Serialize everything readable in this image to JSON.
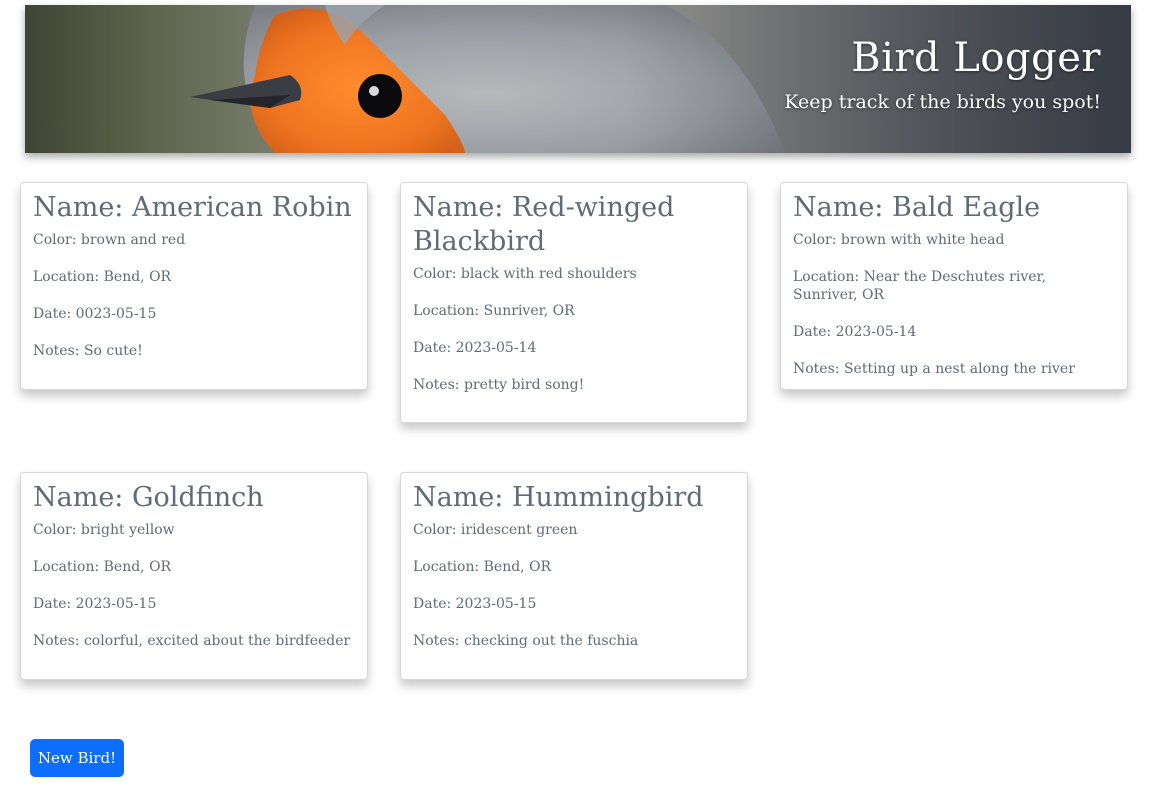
{
  "header": {
    "title": "Bird Logger",
    "subtitle": "Keep track of the birds you spot!"
  },
  "birds": [
    {
      "name": "Name: American Robin",
      "color": "Color: brown and red",
      "location": "Location: Bend, OR",
      "date": "Date: 0023-05-15",
      "notes": "Notes: So cute!"
    },
    {
      "name": "Name: Red-winged Blackbird",
      "color": "Color: black with red shoulders",
      "location": "Location: Sunriver, OR",
      "date": "Date: 2023-05-14",
      "notes": "Notes: pretty bird song!"
    },
    {
      "name": "Name: Bald Eagle",
      "color": "Color: brown with white head",
      "location": "Location: Near the Deschutes river, Sunriver, OR",
      "date": "Date: 2023-05-14",
      "notes": "Notes: Setting up a nest along the river"
    },
    {
      "name": "Name: Goldfinch",
      "color": "Color: bright yellow",
      "location": "Location: Bend, OR",
      "date": "Date: 2023-05-15",
      "notes": "Notes: colorful, excited about the birdfeeder"
    },
    {
      "name": "Name: Hummingbird",
      "color": "Color: iridescent green",
      "location": "Location: Bend, OR",
      "date": "Date: 2023-05-15",
      "notes": "Notes: checking out the fuschia"
    }
  ],
  "actions": {
    "new_bird_label": "New Bird!"
  },
  "colors": {
    "primary_button": "#0d6efd",
    "text": "#5f6b75",
    "card_border": "#d7d7d7"
  }
}
